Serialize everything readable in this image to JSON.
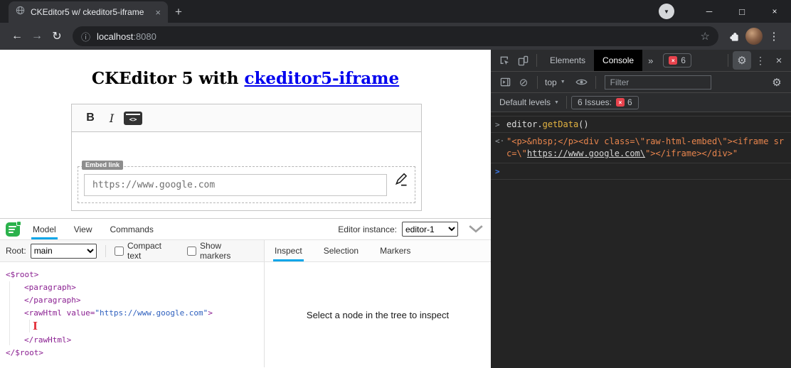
{
  "icons": {
    "back": "←",
    "forward": "→",
    "reload": "↻",
    "info": "ⓘ",
    "star": "☆",
    "kebab": "⋮",
    "win_min": "─",
    "win_max": "□",
    "win_close": "×",
    "tab_close": "×",
    "new_tab": "+",
    "download_caret": "▼",
    "dropdown_caret": "▼",
    "more_tabs": "»",
    "gear": "⚙",
    "block": "⊘",
    "issue_x": "×",
    "cursor_ibeam": "I"
  },
  "chrome": {
    "tab_title": "CKEditor5 w/ ckeditor5-iframe",
    "url_host": "localhost",
    "url_port": ":8080"
  },
  "page": {
    "heading": {
      "prefix": "CKEditor 5 with ",
      "link": "ckeditor5-iframe"
    },
    "editor": {
      "bold_label": "B",
      "italic_label": "I",
      "embed_icon_label": "<>",
      "embed_label": "Embed link",
      "embed_value": "https://www.google.com"
    },
    "inspector": {
      "tabs": {
        "model": "Model",
        "view": "View",
        "commands": "Commands"
      },
      "instance_label": "Editor instance:",
      "instance_value": "editor-1",
      "root_label": "Root:",
      "root_value": "main",
      "compact_text_label": "Compact text",
      "show_markers_label": "Show markers",
      "pane_tabs": {
        "inspect": "Inspect",
        "selection": "Selection",
        "markers": "Markers"
      },
      "tree": {
        "root_open": "<$root>",
        "paragraph_open": "<paragraph>",
        "paragraph_close": "</paragraph>",
        "rawhtml_open": "<rawHtml ",
        "attr_name": "value=",
        "attr_value": "\"https://www.google.com\"",
        "tag_end": ">",
        "rawhtml_close": "</rawHtml>",
        "root_close": "</$root>"
      },
      "empty_message": "Select a node in the tree to inspect"
    }
  },
  "devtools": {
    "tab_elements": "Elements",
    "tab_console": "Console",
    "more_tabs": "»",
    "error_count": "6",
    "context_selector": "top",
    "filter_placeholder": "Filter",
    "levels_label": "Default levels",
    "issues_label": "6 Issues:",
    "issues_count": "6",
    "console": {
      "prompt_in": ">",
      "input_object": "editor",
      "input_dot": ".",
      "input_method": "getData",
      "input_parens": "()",
      "result_arrow": "<·",
      "result_pre": "\"<p>&nbsp;</p><div class=\\\"raw-html-embed\\\"><iframe src=\\\"",
      "result_link": "https://www.google.com\\",
      "result_post": "\"></iframe></div>\"",
      "prompt_new": ">"
    }
  }
}
